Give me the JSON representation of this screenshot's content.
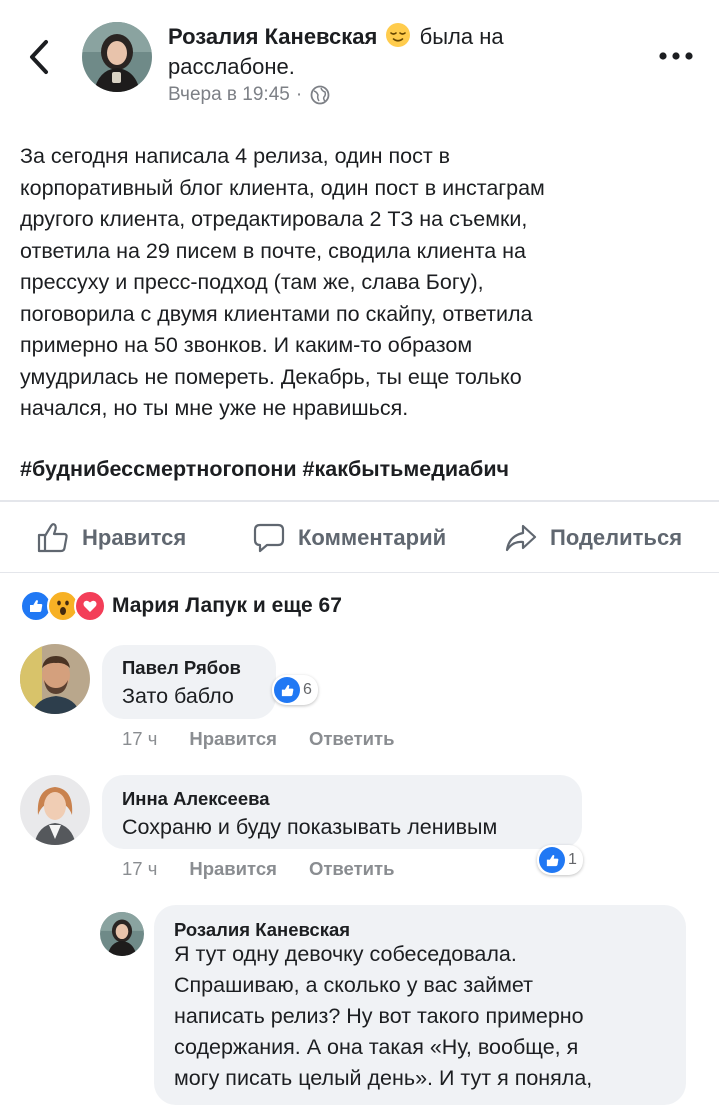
{
  "post": {
    "author_name": "Розалия Каневская",
    "feeling_text": " была на расслабоне.",
    "feeling_icon": "relieved-face-emoji",
    "timestamp": "Вчера в 19:45",
    "separator": "·",
    "privacy_icon": "globe-icon",
    "body": "За сегодня написала 4 релиза, один пост в\nкорпоративный блог клиента, один пост в инстаграм\nдругого клиента, отредактировала 2 ТЗ на съемки,\nответила на 29 писем в почте, сводила клиента на\nпрессуху и пресс-подход (там же, слава Богу),\nпоговорила с двумя клиентами по скайпу, ответила\nпримерно на 50 звонков. И каким-то образом\nумудрилась не помереть. Декабрь, ты еще только\nначался, но ты мне уже не нравишься.",
    "hashtags": "#буднибессмертногопони #какбытьмедиабич"
  },
  "actions": {
    "like": "Нравится",
    "comment": "Комментарий",
    "share": "Поделиться"
  },
  "reactions": {
    "icons": [
      "like-reaction",
      "wow-reaction",
      "love-reaction"
    ],
    "summary": "Мария Лапук и еще 67"
  },
  "comments": [
    {
      "author": "Павел Рябов",
      "text": "Зато бабло",
      "time": "17 ч",
      "like_label": "Нравится",
      "reply_label": "Ответить",
      "likes": "6"
    },
    {
      "author": "Инна Алексеева",
      "text": "Сохраню и буду показывать ленивым",
      "time": "17 ч",
      "like_label": "Нравится",
      "reply_label": "Ответить",
      "likes": "1"
    }
  ],
  "reply": {
    "author": "Розалия Каневская",
    "text": "Я тут одну девочку собеседовала.\nСпрашиваю, а сколько у вас займет\nнаписать релиз? Ну вот такого примерно\nсодержания. А она такая «Ну, вообще, я\nмогу писать целый день». И тут я поняла,"
  },
  "colors": {
    "facebook_blue": "#1877f2",
    "like_blue": "#2078f4",
    "love_red": "#f33e58",
    "wow_yellow": "#f7b125",
    "bubble_gray": "#f0f2f5",
    "meta_gray": "#8a8d91"
  }
}
